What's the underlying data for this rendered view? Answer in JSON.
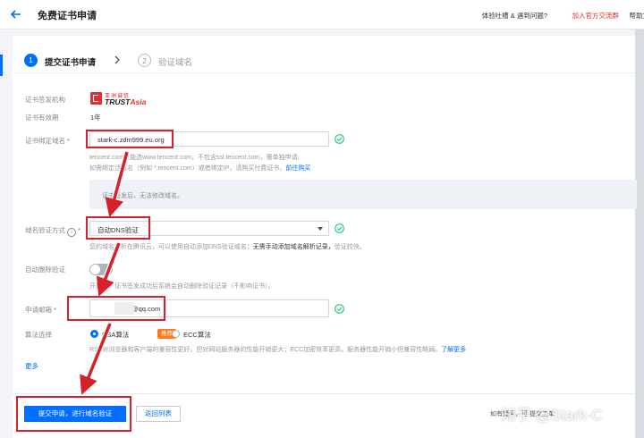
{
  "header": {
    "title": "免费证书申请",
    "feedback": "体验吐槽 & 遇到问题?",
    "join_group": "加入官方交流群",
    "help": "帮助文"
  },
  "steps": [
    {
      "num": "1",
      "label": "提交证书申请"
    },
    {
      "num": "2",
      "label": "验证域名"
    }
  ],
  "form": {
    "issuer_label": "证书签发机构",
    "issuer_logo_cn": "亚洲诚信",
    "issuer_logo_en_a": "TRUST",
    "issuer_logo_en_b": "Asia",
    "validity_label": "证书有效期",
    "validity_value": "1年",
    "domain_label": "证书绑定域名",
    "domain_value": "stark-c.zdm999.eu.org",
    "domain_hint_1": "tencent.com只能选www.tencent.com，不包含ssl.tencent.com，需单独申请;",
    "domain_hint_2": "如需绑定泛域名（例如 *.tencent.com）或者绑定IP，请购买付费证书。",
    "domain_hint_link": "前往购买",
    "notice_text": "证书签发后，无法修改域名。",
    "verify_label": "域名验证方式",
    "verify_value": "自动DNS验证",
    "verify_hint_a": "您的域名解析在腾讯云，可以使用自动添加DNS验证域名；",
    "verify_hint_b": "无需手动添加域名解析记录，",
    "verify_hint_c": "验证较快。",
    "auto_delete_label": "自动删除验证",
    "auto_delete_hint": "开启后，证书签发成功后系统会自动删除验证记录（不影响证书）。",
    "email_label": "申请邮箱",
    "email_value": "@qq.com",
    "algo_label": "算法选择",
    "algo_rsa": "RSA算法",
    "algo_badge": "推荐",
    "algo_ecc": "ECC算法",
    "algo_hint": "RSA对浏览器和客户端的兼容性更好，但对网站服务器的性能开销更大；ECC加密效率更高，服务器性能开销小但兼容性略弱。",
    "algo_hint_link": "了解更多",
    "more": "更多"
  },
  "footer": {
    "submit": "提交申请，进行域名验证",
    "back": "返回列表",
    "right_text": "如有疑问，可 提交工单 ",
    "watermark": "知乎 @Stark-C"
  },
  "colors": {
    "primary": "#006eff",
    "success": "#29cc85",
    "annotation": "#d8202a",
    "badge": "#ff7a1a"
  }
}
